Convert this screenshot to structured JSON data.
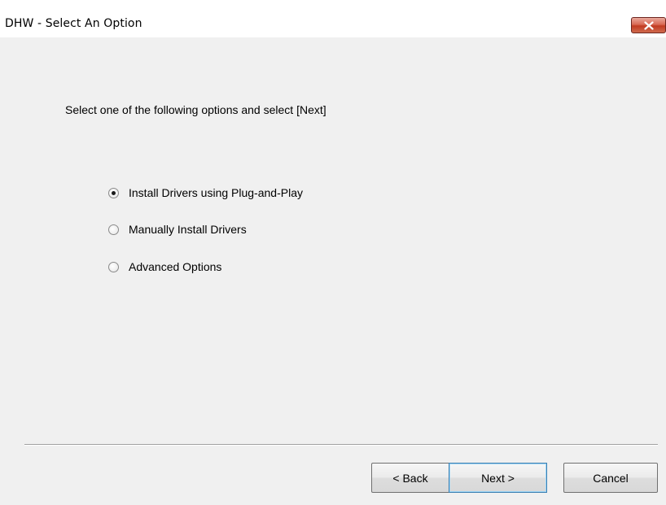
{
  "window": {
    "title": "DHW - Select An Option",
    "close_icon": "close-icon"
  },
  "main": {
    "instruction": "Select one of the following options and select [Next]",
    "options": [
      {
        "label": "Install Drivers using Plug-and-Play",
        "selected": true
      },
      {
        "label": "Manually Install Drivers",
        "selected": false
      },
      {
        "label": "Advanced Options",
        "selected": false
      }
    ]
  },
  "footer": {
    "back_label": "< Back",
    "next_label": "Next >",
    "cancel_label": "Cancel"
  }
}
